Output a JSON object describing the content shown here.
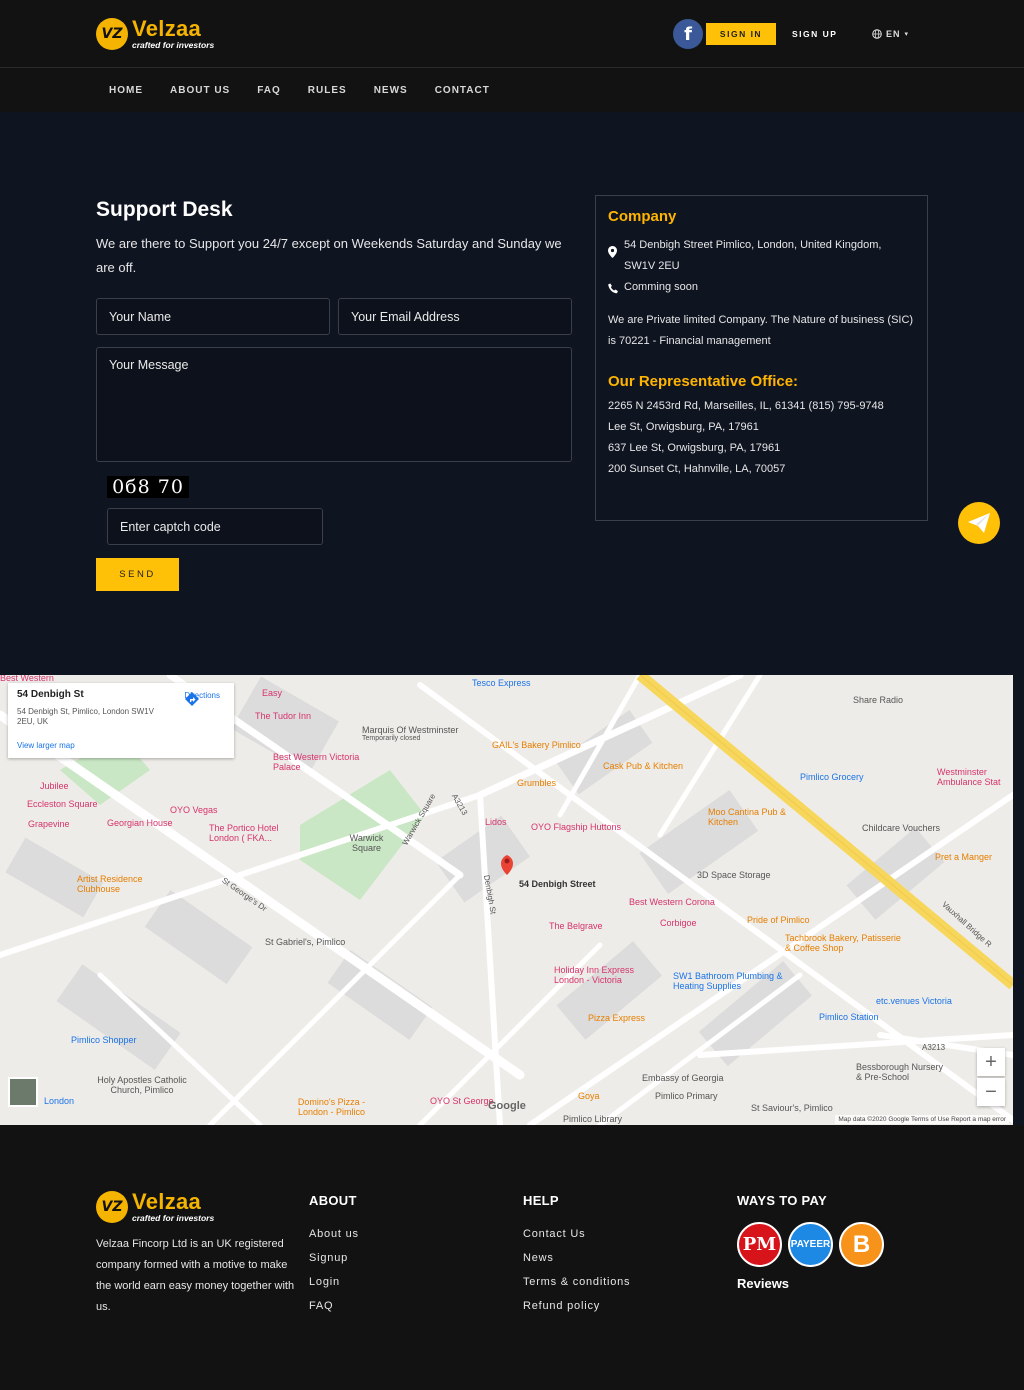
{
  "header": {
    "brand": "Velzaa",
    "tagline": "crafted for investors",
    "logo_initials": "VZ",
    "signin_label": "SIGN IN",
    "signup_label": "SIGN UP",
    "language": "EN"
  },
  "nav": [
    "HOME",
    "ABOUT US",
    "FAQ",
    "RULES",
    "NEWS",
    "CONTACT"
  ],
  "support": {
    "title": "Support Desk",
    "description": "We are there to Support you 24/7 except on Weekends Saturday and Sunday we are off.",
    "name_placeholder": "Your Name",
    "email_placeholder": "Your Email Address",
    "message_placeholder": "Your Message",
    "captcha": "0",
    "captcha_display": "0б8 70",
    "captcha_placeholder": "Enter captch code",
    "send_label": "SEND"
  },
  "company": {
    "title": "Company",
    "address": "54 Denbigh Street Pimlico, London, United Kingdom, SW1V 2EU",
    "phone": "Comming soon",
    "description": "We are Private limited Company. The Nature of business (SIC) is 70221 - Financial management",
    "office_title": "Our Representative Office:",
    "offices": [
      "2265 N 2453rd Rd, Marseilles, IL, 61341 (815) 795-9748",
      "Lee St, Orwigsburg, PA, 17961",
      "637 Lee St, Orwigsburg, PA, 17961",
      "200 Sunset Ct, Hahnville, LA, 70057"
    ]
  },
  "map": {
    "card_title": "54 Denbigh St",
    "card_address": "54 Denbigh St, Pimlico, London SW1V 2EU, UK",
    "card_link": "View larger map",
    "directions": "Directions",
    "pin_label": "54 Denbigh Street",
    "labels": {
      "l1": "Best Western",
      "l2": "Tesco Express",
      "l3": "Easy",
      "l4": "The Tudor Inn",
      "l5": "Marquis Of Westminster",
      "l6": "Temporarily closed",
      "l7": "Share Radio",
      "l8": "Best Western Victoria Palace",
      "l9": "GAIL's Bakery Pimlico",
      "l10": "Cask Pub & Kitchen",
      "l11": "Pimlico Grocery",
      "l12": "Westminster Ambulance Stat",
      "l13": "Jubilee",
      "l14": "Eccleston Square",
      "l15": "OYO Vegas",
      "l16": "Grumbles",
      "l17": "Grapevine",
      "l18": "Georgian House",
      "l19": "The Portico Hotel London ( FKA...",
      "l20": "Lidos",
      "l21": "OYO Flagship Huttons",
      "l22": "Moo Cantina Pub & Kitchen",
      "l23": "Childcare Vouchers",
      "l24": "Warwick Square",
      "l25": "Pret a Manger",
      "l26": "Artist Residence Clubhouse",
      "l27": "3D Space Storage",
      "l28": "Best Western Corona",
      "l29": "The Belgrave",
      "l30": "Corbigoe",
      "l31": "Pride of Pimlico",
      "l32": "Tachbrook Bakery, Patisserie & Coffee Shop",
      "l33": "St Gabriel's, Pimlico",
      "l34": "Holiday Inn Express London - Victoria",
      "l35": "SW1 Bathroom Plumbing & Heating Supplies",
      "l36": "etc.venues Victoria",
      "l37": "Pimlico Station",
      "l38": "Pizza Express",
      "l39": "Pimlico Shopper",
      "l40": "Holy Apostles Catholic Church, Pimlico",
      "l41": "Embassy of Georgia",
      "l42": "Bessborough Nursery & Pre-School",
      "l43": "Domino's Pizza - London - Pimlico",
      "l44": "OYO St George",
      "l45": "Goya",
      "l46": "Pimlico Primary",
      "l47": "St Saviour's, Pimlico",
      "l48": "Pimlico Library",
      "l49": "London"
    },
    "streets": {
      "s1": "A3213",
      "s2": "St George's Dr",
      "s3": "Vauxhall Bridge R",
      "s4": "Denbigh St",
      "s5": "Warwick Square",
      "s6": "A3213"
    },
    "footer": "Map data ©2020 Google   Terms of Use   Report a map error",
    "google": "Google"
  },
  "footer": {
    "about_text": "Velzaa Fincorp Ltd is an UK registered company formed with a motive to make the world earn easy money together with us.",
    "about_title": "ABOUT",
    "about_links": [
      "About us",
      "Signup",
      "Login",
      "FAQ"
    ],
    "help_title": "HELP",
    "help_links": [
      "Contact Us",
      "News",
      "Terms & conditions",
      "Refund policy"
    ],
    "pay_title": "WAYS TO PAY",
    "pay_pm": "PM",
    "pay_payeer": "PAYEER",
    "pay_btc": "B",
    "reviews": "Reviews"
  },
  "colors": {
    "accent": "#ffc107",
    "background": "#0f1421",
    "header": "#121212"
  }
}
